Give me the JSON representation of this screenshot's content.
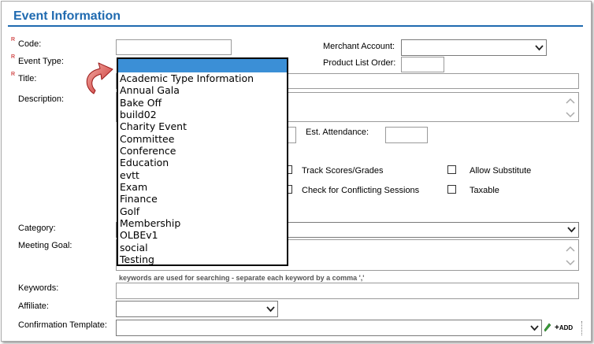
{
  "header": {
    "title": "Event Information"
  },
  "required_marker": "R",
  "labels": {
    "code": "Code:",
    "event_type": "Event Type:",
    "title": "Title:",
    "description": "Description:",
    "merchant_account": "Merchant Account:",
    "product_list_order": "Product List Order:",
    "est_attendance": "Est. Attendance:",
    "category": "Category:",
    "meeting_goal": "Meeting Goal:",
    "keywords": "Keywords:",
    "affiliate": "Affiliate:",
    "confirmation_template": "Confirmation Template:"
  },
  "checkboxes": {
    "track_scores": "Track Scores/Grades",
    "allow_substitute": "Allow Substitute",
    "check_conflicting": "Check for Conflicting Sessions",
    "taxable": "Taxable"
  },
  "keywords_hint": "keywords are used for searching - separate each keyword by a comma ','",
  "add_label": "ADD",
  "event_type_options": [
    "Academic Type Information",
    "Annual Gala",
    "Bake Off",
    "build02",
    "Charity Event",
    "Committee",
    "Conference",
    "Education",
    "evtt",
    "Exam",
    "Finance",
    "Golf",
    "Membership",
    "OLBEv1",
    "social",
    "Testing"
  ],
  "colors": {
    "title": "#1f6ab0",
    "required": "#c00000",
    "highlight": "#3b8fd6",
    "arrow": "#d23a3a"
  }
}
